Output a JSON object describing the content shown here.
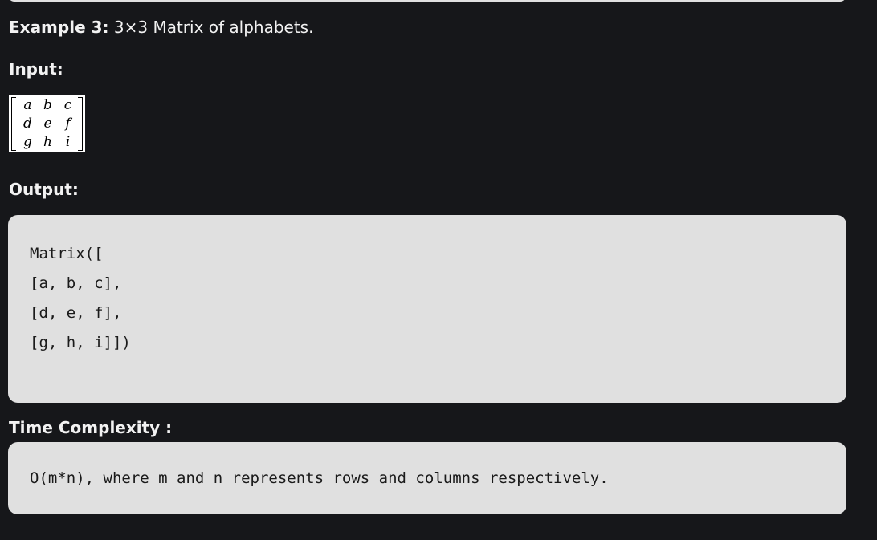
{
  "example": {
    "label": "Example 3:",
    "description": " 3×3 Matrix of alphabets."
  },
  "input_label": "Input:",
  "matrix": [
    [
      "a",
      "b",
      "c"
    ],
    [
      "d",
      "e",
      "f"
    ],
    [
      "g",
      "h",
      "i"
    ]
  ],
  "output_label": "Output:",
  "output_code": [
    "Matrix([",
    "[a, b, c],",
    "[d, e, f],",
    "[g, h, i]])"
  ],
  "complexity_label": "Time Complexity :",
  "complexity_text": "O(m*n), where m and n represents rows and columns respectively."
}
